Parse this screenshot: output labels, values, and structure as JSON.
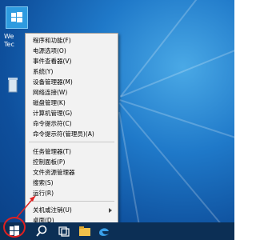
{
  "desktop": {
    "icon_labels": [
      "We",
      "Tec"
    ]
  },
  "context_menu": {
    "items": [
      {
        "label": "程序和功能(F)"
      },
      {
        "label": "电源选项(O)"
      },
      {
        "label": "事件查看器(V)"
      },
      {
        "label": "系统(Y)"
      },
      {
        "label": "设备管理器(M)"
      },
      {
        "label": "网络连接(W)"
      },
      {
        "label": "磁盘管理(K)"
      },
      {
        "label": "计算机管理(G)"
      },
      {
        "label": "命令提示符(C)"
      },
      {
        "label": "命令提示符(管理员)(A)"
      },
      {
        "label": "任务管理器(T)"
      },
      {
        "label": "控制面板(P)"
      },
      {
        "label": "文件资源管理器"
      },
      {
        "label": "搜索(S)"
      },
      {
        "label": "运行(R)"
      },
      {
        "label": "关机或注销(U)"
      },
      {
        "label": "桌面(D)"
      }
    ]
  },
  "taskbar": {
    "buttons": [
      "start-button",
      "search-button",
      "task-view-button",
      "file-explorer-button",
      "edge-button"
    ]
  },
  "colors": {
    "menu_bg": "#f2f2f2",
    "annotation_red": "#e02020",
    "taskbar_bg": "#0c2f55",
    "desktop_blue": "#1f79c9"
  }
}
